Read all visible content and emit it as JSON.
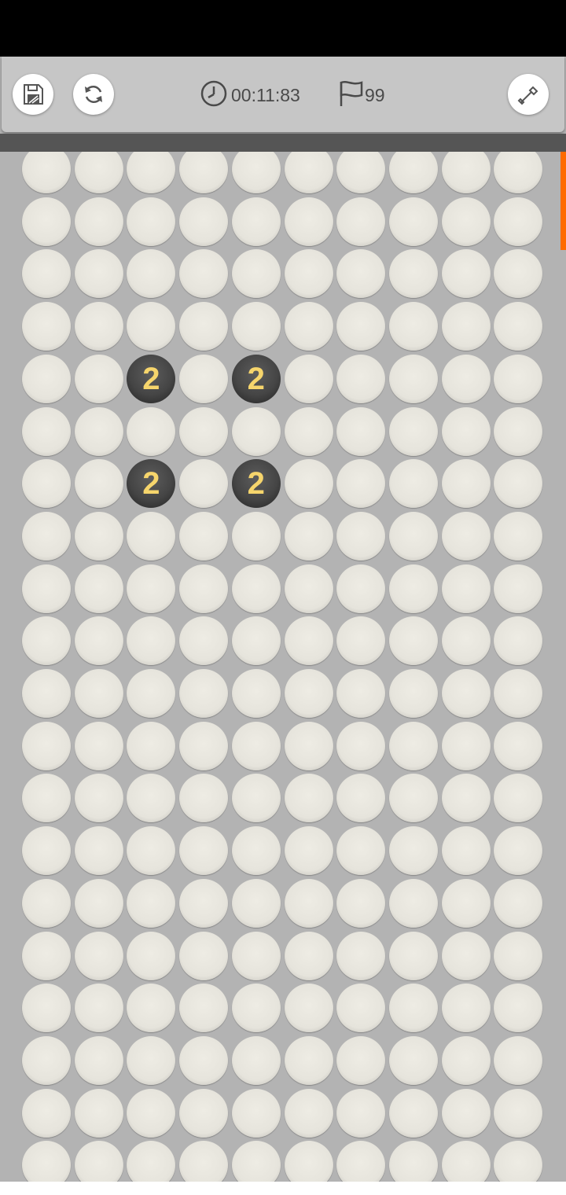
{
  "toolbar": {
    "timer": "00:11:83",
    "flags": "99",
    "buttons": {
      "save_icon": "floppy-disk-icon",
      "restart_icon": "refresh-icon",
      "dig_icon": "shovel-icon"
    }
  },
  "board": {
    "columns": 10,
    "visible_rows": 20,
    "revealed": [
      {
        "row": 4,
        "col": 2,
        "value": "2"
      },
      {
        "row": 4,
        "col": 4,
        "value": "2"
      },
      {
        "row": 6,
        "col": 2,
        "value": "2"
      },
      {
        "row": 6,
        "col": 4,
        "value": "2"
      }
    ]
  },
  "colors": {
    "number": "#f6d56c",
    "scroll_indicator": "#ff6a00",
    "board_background": "#b3b3b3"
  }
}
